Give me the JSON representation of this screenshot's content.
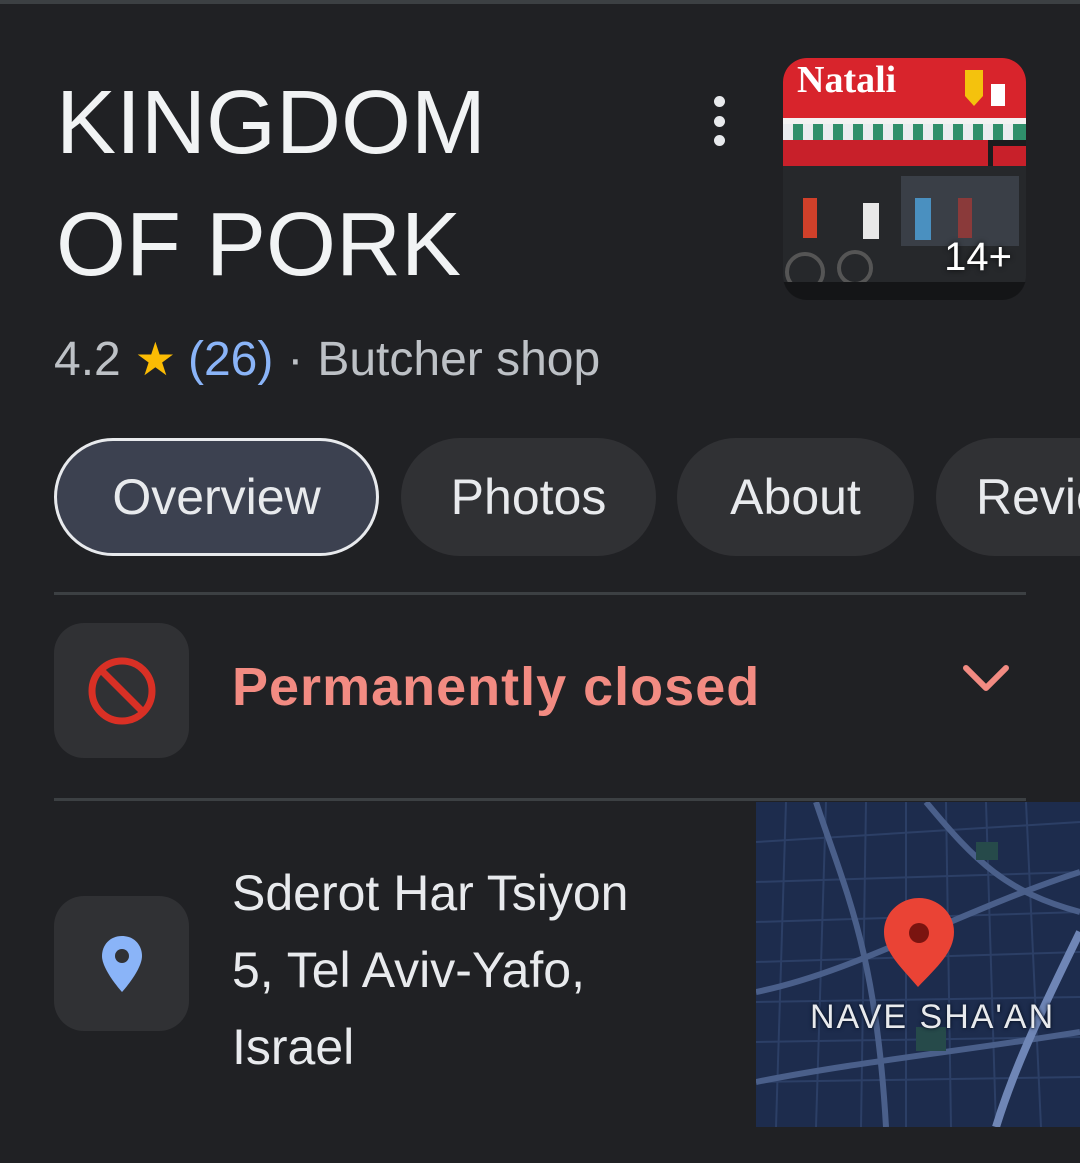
{
  "place": {
    "name_line1": "KINGDOM",
    "name_line2": "OF PORK",
    "photo_count": "14+",
    "photo_sign_text": "Natali"
  },
  "rating": {
    "score": "4.2",
    "star": "★",
    "reviews": "(26)",
    "separator": "·",
    "category": "Butcher shop"
  },
  "tabs": [
    {
      "label": "Overview",
      "active": true
    },
    {
      "label": "Photos",
      "active": false
    },
    {
      "label": "About",
      "active": false
    },
    {
      "label": "Reviews",
      "active": false
    }
  ],
  "status": {
    "text": "Permanently closed",
    "icon": "block-icon",
    "color": "#f28b82"
  },
  "address": {
    "line1": "Sderot Har Tsiyon",
    "line2": "5, Tel Aviv-Yafo,",
    "line3": "Israel",
    "icon": "location-pin-icon"
  },
  "map": {
    "neighborhood_label": "NAVE SHA'AN",
    "pin_color": "#ea4335"
  },
  "colors": {
    "background": "#202124",
    "chip": "#303134",
    "link": "#8ab4f8",
    "star": "#fbbc04"
  }
}
